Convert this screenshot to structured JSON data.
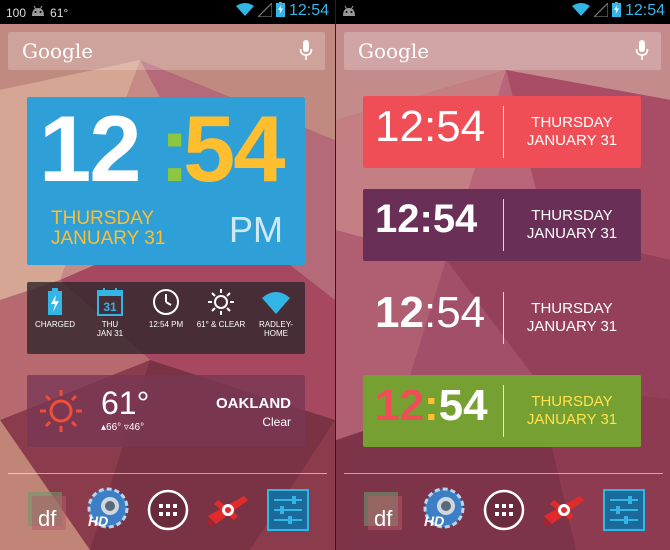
{
  "colors": {
    "holo_blue": "#33b5e5",
    "clock_blue": "#2f9fd8",
    "clock_yellow": "#ffbe2e",
    "clock_green": "#8dc63f",
    "red_widget": "#f04e56",
    "purple_widget": "#6a2f57",
    "green_widget": "#76a032"
  },
  "left": {
    "status": {
      "notification_count": "100",
      "temperature": "61°",
      "time": "12:54"
    },
    "search": {
      "logo": "Google",
      "mic_icon": "mic-icon"
    },
    "big_clock": {
      "hour": "12",
      "colon": ":",
      "minute": "54",
      "day": "THURSDAY",
      "date": "JANUARY 31",
      "ampm": "PM"
    },
    "info_row": {
      "battery": {
        "line1": "CHARGED",
        "line2": ""
      },
      "calendar": {
        "number": "31",
        "line1": "THU",
        "line2": "JAN 31"
      },
      "clock": {
        "line1": "12:54 PM",
        "line2": ""
      },
      "weather": {
        "line1": "61° & CLEAR",
        "line2": ""
      },
      "wifi": {
        "line1": "RADLEY-",
        "line2": "HOME"
      }
    },
    "weather_widget": {
      "temp": "61°",
      "hilo": "▴66° ▿46°",
      "city": "OAKLAND",
      "condition": "Clear"
    },
    "dock": [
      "doubletwist-icon",
      "hd-widgets-icon",
      "app-drawer-icon",
      "airplane-icon",
      "settings-sliders-icon"
    ]
  },
  "right": {
    "status": {
      "time": "12:54"
    },
    "search": {
      "logo": "Google"
    },
    "widgets": [
      {
        "time": "12:54",
        "day": "THURSDAY",
        "date": "JANUARY 31"
      },
      {
        "time": "12:54",
        "day": "THURSDAY",
        "date": "JANUARY 31"
      },
      {
        "hour": "12",
        "sep": ":",
        "minute": "54",
        "day": "THURSDAY",
        "date": "JANUARY 31"
      },
      {
        "hour": "12",
        "sep": ":",
        "minute": "54",
        "day": "THURSDAY",
        "date": "JANUARY 31"
      }
    ]
  }
}
